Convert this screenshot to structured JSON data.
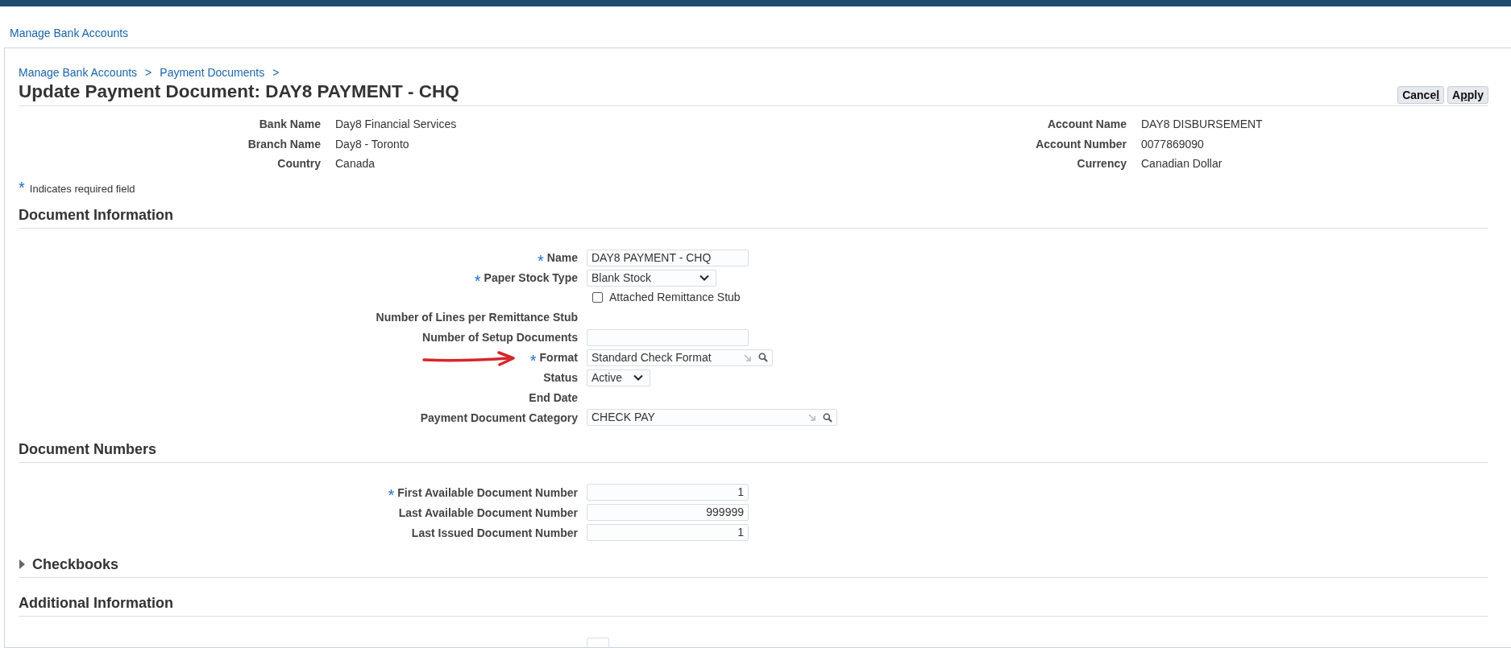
{
  "top_link": "Manage Bank Accounts",
  "breadcrumbs": [
    {
      "label": "Manage Bank Accounts"
    },
    {
      "label": "Payment Documents"
    }
  ],
  "breadcrumb_separator": ">",
  "title": "Update Payment Document: DAY8 PAYMENT - CHQ",
  "buttons": [
    {
      "before": "Cance",
      "mnemonic": "l"
    },
    {
      "before": "A",
      "mnemonic": "p",
      "after": "ply"
    }
  ],
  "header_info": {
    "left": [
      {
        "label": "Bank Name",
        "value": "Day8 Financial Services"
      },
      {
        "label": "Branch Name",
        "value": "Day8 - Toronto"
      },
      {
        "label": "Country",
        "value": "Canada"
      }
    ],
    "right": [
      {
        "label": "Account Name",
        "value": "DAY8 DISBURSEMENT"
      },
      {
        "label": "Account Number",
        "value": "0077869090"
      },
      {
        "label": "Currency",
        "value": "Canadian Dollar"
      }
    ]
  },
  "required_marker": "*",
  "required_note": "Indicates required field",
  "sections": [
    {
      "title": "Document Information",
      "fields": [
        {
          "kind": "text",
          "label": "Name",
          "required": true,
          "value": "DAY8 PAYMENT - CHQ"
        },
        {
          "kind": "select",
          "label": "Paper Stock Type",
          "required": true,
          "value": "Blank Stock"
        },
        {
          "kind": "checkbox",
          "text": "Attached Remittance Stub",
          "checked": false
        },
        {
          "kind": "readonly",
          "label": "Number of Lines per Remittance Stub",
          "required": false
        },
        {
          "kind": "text",
          "label": "Number of Setup Documents",
          "required": false
        },
        {
          "kind": "lov",
          "label": "Format",
          "required": true,
          "value": "Standard Check Format",
          "annotated": true,
          "wide": false
        },
        {
          "kind": "select",
          "label": "Status",
          "required": false,
          "value": "Active"
        },
        {
          "kind": "readonly",
          "label": "End Date",
          "required": false
        },
        {
          "kind": "lov",
          "label": "Payment Document Category",
          "required": false,
          "value": "CHECK PAY",
          "wide": true
        }
      ]
    },
    {
      "title": "Document Numbers",
      "fields": [
        {
          "kind": "number",
          "label": "First Available Document Number",
          "required": true,
          "value": "1"
        },
        {
          "kind": "number",
          "label": "Last Available Document Number",
          "required": false,
          "value": "999999"
        },
        {
          "kind": "number",
          "label": "Last Issued Document Number",
          "required": false,
          "value": "1"
        }
      ]
    },
    {
      "title": "Checkbooks",
      "expanded": false
    },
    {
      "title": "Additional Information",
      "fields": [
        {
          "kind": "stub",
          "required": false
        }
      ]
    }
  ]
}
